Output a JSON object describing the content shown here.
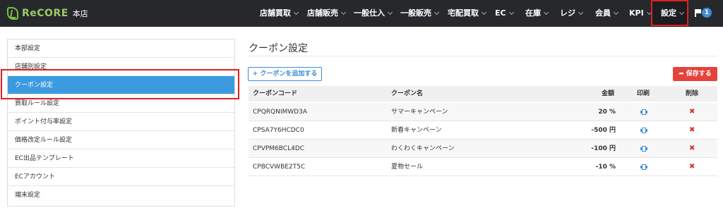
{
  "brand": {
    "name": "ReCORE",
    "store": "本店"
  },
  "nav": {
    "items": [
      {
        "label": "店舗買取"
      },
      {
        "label": "店舗販売"
      },
      {
        "label": "一般仕入"
      },
      {
        "label": "一般販売"
      },
      {
        "label": "宅配買取"
      },
      {
        "label": "EC"
      },
      {
        "label": "在庫"
      },
      {
        "label": "レジ"
      },
      {
        "label": "会員"
      },
      {
        "label": "KPI"
      },
      {
        "label": "設定"
      }
    ],
    "notification_count": "1"
  },
  "sidebar": {
    "items": [
      {
        "label": "本部設定"
      },
      {
        "label": "店舗別設定"
      },
      {
        "label": "クーポン設定"
      },
      {
        "label": "買取ルール設定"
      },
      {
        "label": "ポイント付与率設定"
      },
      {
        "label": "価格改定ルール設定"
      },
      {
        "label": "EC出品テンプレート"
      },
      {
        "label": "ECアカウント"
      },
      {
        "label": "端末設定"
      }
    ]
  },
  "main": {
    "title": "クーポン設定",
    "add_button": "+ クーポンを追加する",
    "save_button": "保存する",
    "table": {
      "headers": {
        "code": "クーポンコード",
        "name": "クーポン名",
        "amount": "金額",
        "print": "印刷",
        "delete": "削除"
      },
      "rows": [
        {
          "code": "CPQRQNIMWD3A",
          "name": "サマーキャンペーン",
          "amount": "20 %"
        },
        {
          "code": "CPSA7Y6HCDC0",
          "name": "新春キャンペーン",
          "amount": "-500 円"
        },
        {
          "code": "CPVPM6BCL4DC",
          "name": "わくわくキャンペーン",
          "amount": "-100 円"
        },
        {
          "code": "CPBCVWBE2T5C",
          "name": "夏物セール",
          "amount": "-10 %"
        }
      ]
    }
  },
  "colors": {
    "topbar": "#26282c",
    "accent": "#3c9be0",
    "danger": "#e5423b",
    "highlight": "#e0201f"
  },
  "icons": {
    "print": "printer-icon",
    "delete": "close-icon",
    "save": "share-icon",
    "notification": "flag-icon"
  }
}
